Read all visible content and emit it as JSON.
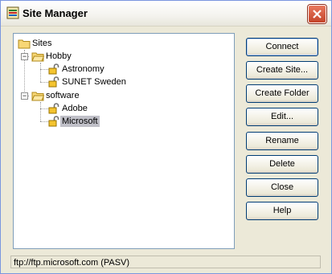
{
  "window": {
    "title": "Site Manager"
  },
  "tree": {
    "root": {
      "label": "Sites",
      "icon": "folder-icon"
    },
    "groups": [
      {
        "label": "Hobby",
        "expander": "−",
        "icon": "folder-open-icon",
        "sites": [
          {
            "label": "Astronomy",
            "icon": "lock-icon"
          },
          {
            "label": "SUNET Sweden",
            "icon": "lock-icon"
          }
        ]
      },
      {
        "label": "software",
        "expander": "−",
        "icon": "folder-open-icon",
        "sites": [
          {
            "label": "Adobe",
            "icon": "lock-icon"
          },
          {
            "label": "Microsoft",
            "icon": "lock-icon",
            "selected": true
          }
        ]
      }
    ]
  },
  "buttons": {
    "connect": "Connect",
    "create_site": "Create Site...",
    "create_folder": "Create Folder",
    "edit": "Edit...",
    "rename": "Rename",
    "delete": "Delete",
    "close": "Close",
    "help": "Help"
  },
  "status": {
    "text": "ftp://ftp.microsoft.com (PASV)"
  },
  "colors": {
    "selection": "#c0c0c8",
    "title_close": "#c4442a",
    "button_border": "#003c74"
  }
}
